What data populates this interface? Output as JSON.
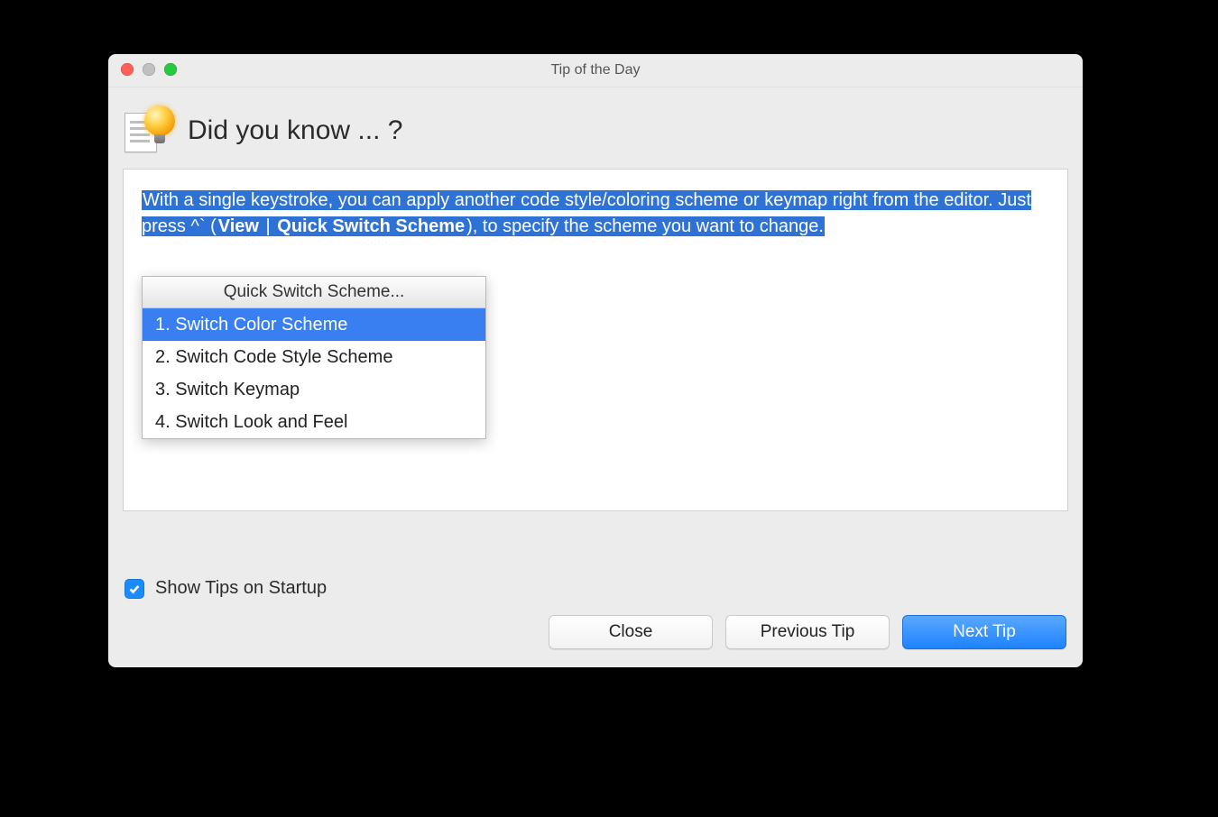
{
  "window": {
    "title": "Tip of the Day"
  },
  "header": {
    "heading": "Did you know ... ?"
  },
  "tip": {
    "text_before": "With a single keystroke, you can apply another code style/coloring scheme or keymap right from the editor. Just press ^` (",
    "bold1": "View",
    "sep": " | ",
    "bold2": "Quick Switch Scheme",
    "text_after": "), to specify the scheme you want to change."
  },
  "popup": {
    "title": "Quick Switch Scheme...",
    "items": [
      "1. Switch Color Scheme",
      "2. Switch Code Style Scheme",
      "3. Switch Keymap",
      "4. Switch Look and Feel"
    ]
  },
  "checkbox": {
    "label": "Show Tips on Startup"
  },
  "buttons": {
    "close": "Close",
    "prev": "Previous Tip",
    "next": "Next Tip"
  }
}
